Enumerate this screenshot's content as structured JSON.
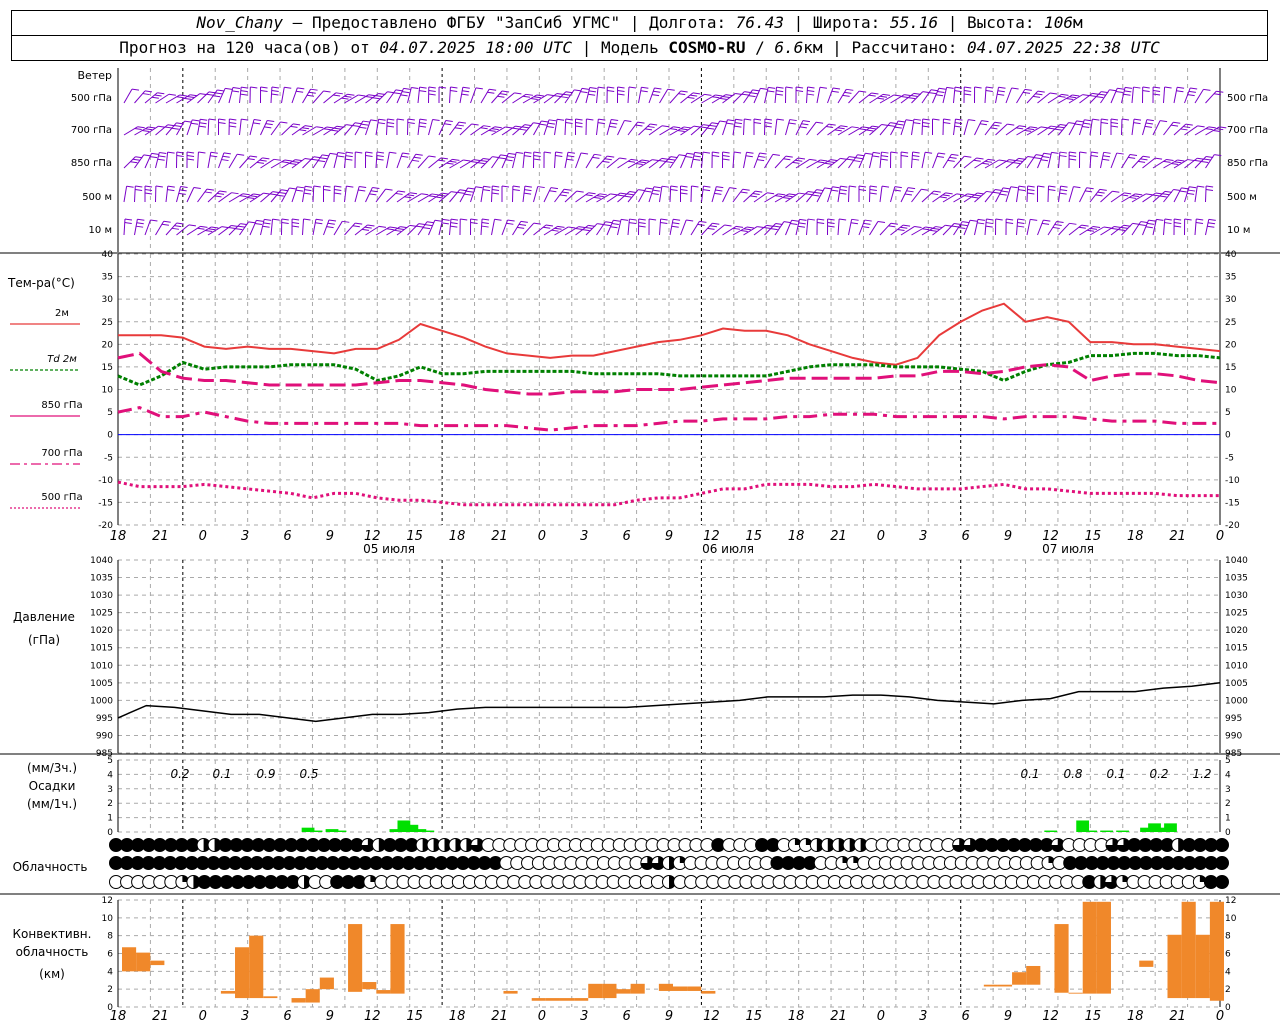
{
  "header": {
    "station": "Nov_Chany",
    "provider": "Предоставлено ФГБУ \"ЗапСиб УГМС\"",
    "lon_label": "Долгота:",
    "lon": "76.43",
    "lat_label": "Широта:",
    "lat": "55.16",
    "alt_label": "Высота:",
    "alt": "106",
    "alt_unit": "м",
    "forecast_label": "Прогноз на 120 часа(ов) от",
    "forecast_time": "04.07.2025 18:00 UTC",
    "model_label": "Модель",
    "model": "COSMO-RU",
    "resolution": "6.6",
    "resolution_unit": "км",
    "computed_label": "Рассчитано:",
    "computed_time": "04.07.2025 22:38 UTC"
  },
  "labels": {
    "wind": "Ветер",
    "wind_levels": [
      "500 гПа",
      "700 гПа",
      "850 гПа",
      "500 м",
      "10 м"
    ],
    "temp_title": "Тем-ра(°C)",
    "temp_legend": [
      "2м",
      "Td 2м",
      "850 гПа",
      "700 гПа",
      "500 гПа"
    ],
    "pressure_title": [
      "Давление",
      "(гПа)"
    ],
    "precip_title": [
      "(мм/3ч.)",
      "Осадки",
      "(мм/1ч.)"
    ],
    "cloud_title": "Облачность",
    "conv_title": [
      "Конвективн.",
      "облачность",
      "(км)"
    ]
  },
  "colors": {
    "t2m": "#e83a3a",
    "td2m": "#008000",
    "t850": "#e0107a",
    "t700": "#e0107a",
    "t500": "#e0107a",
    "wind": "#7a00c8",
    "precip": "#00e000",
    "conv": "#f0882a",
    "zero_line": "#0000ff"
  },
  "chart_data": {
    "type": "line",
    "time_ticks": [
      "18",
      "21",
      "0",
      "3",
      "6",
      "9",
      "12",
      "15",
      "18",
      "21",
      "0",
      "3",
      "6",
      "9",
      "12",
      "15",
      "18",
      "21",
      "0",
      "3",
      "6",
      "9",
      "12",
      "15",
      "18",
      "21",
      "0"
    ],
    "days": [
      "05 июля",
      "06 июля",
      "07 июля"
    ],
    "temperature": {
      "ylim": [
        -20,
        40
      ],
      "series": [
        {
          "name": "2м",
          "values": [
            22,
            22,
            22,
            21.5,
            19.5,
            19,
            19.5,
            19,
            19,
            18.5,
            18,
            19,
            19,
            21,
            24.5,
            23,
            21.5,
            19.5,
            18,
            17.5,
            17,
            17.5,
            17.5,
            18.5,
            19.5,
            20.5,
            21,
            22,
            23.5,
            23,
            23,
            22,
            20,
            18.5,
            17,
            16,
            15.5,
            17,
            22,
            25,
            27.5,
            29,
            25,
            26,
            25,
            20.5,
            20.5,
            20,
            20,
            19.5,
            19,
            18.5
          ]
        },
        {
          "name": "Td 2м",
          "values": [
            13,
            11,
            13,
            16,
            14.5,
            15,
            15,
            15,
            15.5,
            15.5,
            15.5,
            14.5,
            12,
            13,
            15,
            13.5,
            13.5,
            14,
            14,
            14,
            14,
            14,
            13.5,
            13.5,
            13.5,
            13.5,
            13,
            13,
            13,
            13,
            13,
            14,
            15,
            15.5,
            15.5,
            15.5,
            15,
            15,
            15,
            14.5,
            14,
            12,
            14,
            15.5,
            16,
            17.5,
            17.5,
            18,
            18,
            17.5,
            17.5,
            17
          ]
        },
        {
          "name": "850 гПа",
          "values": [
            17,
            18,
            14,
            12.5,
            12,
            12,
            11.5,
            11,
            11,
            11,
            11,
            11,
            11.5,
            12,
            12,
            11.5,
            11,
            10,
            9.5,
            9,
            9,
            9.5,
            9.5,
            9.5,
            10,
            10,
            10,
            10.5,
            11,
            11.5,
            12,
            12.5,
            12.5,
            12.5,
            12.5,
            12.5,
            13,
            13,
            14,
            14,
            13.5,
            14,
            15,
            15.5,
            15,
            12,
            13,
            13.5,
            13.5,
            13,
            12,
            11.5
          ]
        },
        {
          "name": "700 гПа",
          "values": [
            5,
            6,
            4,
            4,
            5,
            4,
            3,
            2.5,
            2.5,
            2.5,
            2.5,
            2.5,
            2.5,
            2.5,
            2,
            2,
            2,
            2,
            2,
            1.5,
            1,
            1.5,
            2,
            2,
            2,
            2.5,
            3,
            3,
            3.5,
            3.5,
            3.5,
            4,
            4,
            4.5,
            4.5,
            4.5,
            4,
            4,
            4,
            4,
            4,
            3.5,
            4,
            4,
            4,
            3.5,
            3,
            3,
            3,
            2.5,
            2.5,
            2.5
          ]
        },
        {
          "name": "500 гПа",
          "values": [
            -10.5,
            -11.5,
            -11.5,
            -11.5,
            -11,
            -11.5,
            -12,
            -12.5,
            -13,
            -14,
            -13,
            -13,
            -14,
            -14.5,
            -14.5,
            -15,
            -15.5,
            -15.5,
            -15.5,
            -15.5,
            -15.5,
            -15.5,
            -15.5,
            -15.5,
            -14.5,
            -14,
            -14,
            -13,
            -12,
            -12,
            -11,
            -11,
            -11,
            -11.5,
            -11.5,
            -11,
            -11.5,
            -12,
            -12,
            -12,
            -11.5,
            -11,
            -12,
            -12,
            -12.5,
            -13,
            -13,
            -13,
            -13,
            -13.5,
            -13.5,
            -13.5
          ]
        }
      ]
    },
    "pressure": {
      "ylim": [
        985,
        1040
      ],
      "ticks": [
        985,
        990,
        995,
        1000,
        1005,
        1010,
        1015,
        1020,
        1025,
        1030,
        1035,
        1040
      ],
      "values": [
        995,
        998.5,
        998,
        997,
        996,
        996,
        995,
        994,
        995,
        996,
        996,
        996.5,
        997.5,
        998,
        998,
        998,
        998,
        998,
        998,
        998.5,
        999,
        999.5,
        1000,
        1001,
        1001,
        1001,
        1001.5,
        1001.5,
        1001,
        1000,
        999.5,
        999,
        1000,
        1000.5,
        1002.5,
        1002.5,
        1002.5,
        1003.5,
        1004,
        1005
      ]
    },
    "precip": {
      "ylim": [
        0,
        5
      ],
      "labels_3h": [
        "0.2",
        "0.1",
        "0.9",
        "0.5",
        "0.1",
        "0.8",
        "0.1",
        "0.2",
        "1.2"
      ],
      "hourly_nonzero": [
        [
          23,
          0.3
        ],
        [
          24,
          0.1
        ],
        [
          26,
          0.2
        ],
        [
          27,
          0.1
        ],
        [
          34,
          0.2
        ],
        [
          35,
          0.8
        ],
        [
          36,
          0.5
        ],
        [
          37,
          0.2
        ],
        [
          38,
          0.1
        ],
        [
          116,
          0.1
        ],
        [
          120,
          0.8
        ],
        [
          121,
          0.1
        ],
        [
          123,
          0.1
        ],
        [
          125,
          0.1
        ],
        [
          128,
          0.3
        ],
        [
          129,
          0.6
        ],
        [
          130,
          0.3
        ],
        [
          131,
          0.6
        ]
      ]
    },
    "cloud_rows": {
      "high": "BBBBBBBBHHBBBBBBBBBBBBBTHBBBHHHHHTOOOOOOOOOOOOOOOOOOOOOBOOOBBOQQHHHHHOOOOOOOOTTBBBBBBBTOOOOTTBBBBHBBBB",
      "mid": "BBBBBBBBBBBBBBBBBBBBBBBBBBBBBBBBBBBBOOOOOOOOOOOOOTTHQOOOOOOOOBBBBOOQQOOOOOOOOOOOOOOOOOQOBBBBBBBBBBBBBBB",
      "low": "OOOOOOQHBBBBBBBBBHOOBBBQOOOOOOOOOOOOOOOOOOOOOOOOOOHOOOOOOOOOOOOOOOOOOOOOOOOOOOOOOOOOOOOOBHTQOOOOOOQBB"
    },
    "convective": {
      "ylim": [
        0,
        12
      ],
      "bars": [
        [
          0,
          4,
          6.7
        ],
        [
          1,
          4,
          6.1
        ],
        [
          2,
          4.7,
          5.2
        ],
        [
          7,
          1.5,
          1.8
        ],
        [
          8,
          1,
          6.7
        ],
        [
          9,
          1,
          8
        ],
        [
          10,
          1,
          1.2
        ],
        [
          12,
          0.5,
          1
        ],
        [
          13,
          0.5,
          2
        ],
        [
          14,
          2,
          3.3
        ],
        [
          16,
          1.7,
          9.3
        ],
        [
          17,
          2,
          2.8
        ],
        [
          18,
          1.5,
          1.9
        ],
        [
          19,
          1.5,
          9.3
        ],
        [
          27,
          1.5,
          1.8
        ],
        [
          29,
          0.7,
          1
        ],
        [
          30,
          0.7,
          1
        ],
        [
          31,
          0.7,
          1
        ],
        [
          32,
          0.7,
          1
        ],
        [
          33,
          1,
          2.6
        ],
        [
          34,
          1,
          2.6
        ],
        [
          35,
          1.5,
          2
        ],
        [
          36,
          1.5,
          2.6
        ],
        [
          38,
          1.8,
          2.6
        ],
        [
          39,
          1.8,
          2.3
        ],
        [
          40,
          1.8,
          2.3
        ],
        [
          41,
          1.5,
          1.8
        ],
        [
          61,
          2.3,
          2.5
        ],
        [
          62,
          2.3,
          2.5
        ],
        [
          63,
          2.5,
          3.9
        ],
        [
          64,
          2.5,
          4.6
        ],
        [
          66,
          1.6,
          9.3
        ],
        [
          67,
          1.5,
          1.6
        ],
        [
          68,
          1.5,
          11.8
        ],
        [
          69,
          1.5,
          11.8
        ],
        [
          72,
          4.5,
          5.2
        ],
        [
          74,
          1,
          8.1
        ],
        [
          75,
          1,
          11.8
        ],
        [
          76,
          1,
          8.1
        ],
        [
          77,
          0.7,
          11.8
        ]
      ]
    },
    "wind": {
      "levels": [
        "500 гПа",
        "700 гПа",
        "850 гПа",
        "500 м",
        "10 м"
      ]
    }
  }
}
